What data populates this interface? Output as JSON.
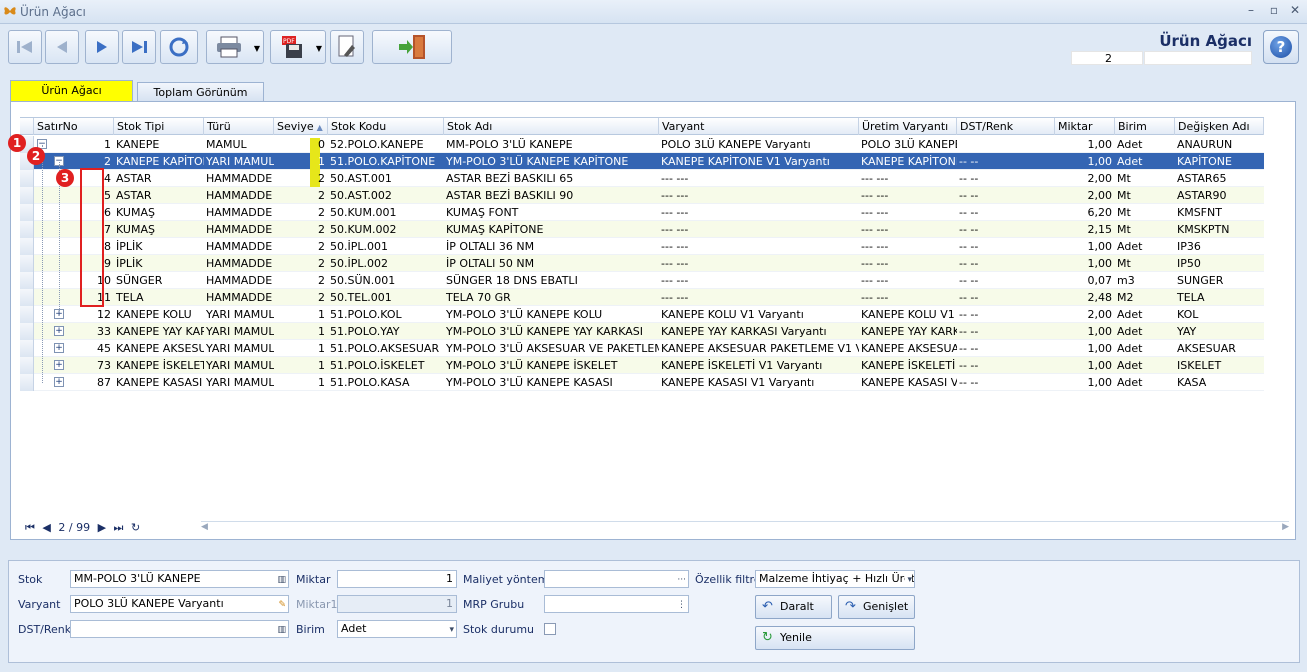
{
  "window": {
    "title": "Ürün Ağacı",
    "minimize": "–",
    "restore": "▫",
    "close": "✕"
  },
  "header": {
    "page_title": "Ürün Ağacı",
    "count_value": "2"
  },
  "tabs": [
    {
      "label": "Ürün Ağacı"
    },
    {
      "label": "Toplam Görünüm"
    }
  ],
  "columns": [
    "SatırNo",
    "Stok Tipi",
    "Türü",
    "Seviye",
    "Stok Kodu",
    "Stok Adı",
    "Varyant",
    "Üretim Varyantı",
    "DST/Renk",
    "Miktar",
    "Birim",
    "Değişken Adı"
  ],
  "rows": [
    {
      "no": "1",
      "tipi": "KANEPE",
      "turu": "MAMUL",
      "seviye": "0",
      "kodu": "52.POLO.KANEPE",
      "adi": "MM-POLO 3'LÜ KANEPE",
      "varyant": "POLO 3LÜ KANEPE Varyantı",
      "uretim": "POLO 3LÜ KANEPE V",
      "dst": "",
      "miktar": "1,00",
      "birim": "Adet",
      "degisken": "ANAURUN",
      "exp": "−"
    },
    {
      "no": "2",
      "tipi": "KANEPE KAPİTONE",
      "turu": "YARI MAMUL",
      "seviye": "1",
      "kodu": "51.POLO.KAPİTONE",
      "adi": "YM-POLO 3'LÜ KANEPE KAPİTONE",
      "varyant": "KANEPE KAPİTONE V1 Varyantı",
      "uretim": "KANEPE KAPİTONE",
      "dst": "-- --",
      "miktar": "1,00",
      "birim": "Adet",
      "degisken": "KAPİTONE",
      "exp": "−"
    },
    {
      "no": "4",
      "tipi": "ASTAR",
      "turu": "HAMMADDE",
      "seviye": "2",
      "kodu": "50.AST.001",
      "adi": "ASTAR BEZİ BASKILI 65",
      "varyant": "--- ---",
      "uretim": "--- ---",
      "dst": "-- --",
      "miktar": "2,00",
      "birim": "Mt",
      "degisken": "ASTAR65",
      "exp": ""
    },
    {
      "no": "5",
      "tipi": "ASTAR",
      "turu": "HAMMADDE",
      "seviye": "2",
      "kodu": "50.AST.002",
      "adi": "ASTAR BEZİ BASKILI 90",
      "varyant": "--- ---",
      "uretim": "--- ---",
      "dst": "-- --",
      "miktar": "2,00",
      "birim": "Mt",
      "degisken": "ASTAR90",
      "exp": ""
    },
    {
      "no": "6",
      "tipi": "KUMAŞ",
      "turu": "HAMMADDE",
      "seviye": "2",
      "kodu": "50.KUM.001",
      "adi": "KUMAŞ FONT",
      "varyant": "--- ---",
      "uretim": "--- ---",
      "dst": "-- --",
      "miktar": "6,20",
      "birim": "Mt",
      "degisken": "KMSFNT",
      "exp": ""
    },
    {
      "no": "7",
      "tipi": "KUMAŞ",
      "turu": "HAMMADDE",
      "seviye": "2",
      "kodu": "50.KUM.002",
      "adi": "KUMAŞ KAPİTONE",
      "varyant": "--- ---",
      "uretim": "--- ---",
      "dst": "-- --",
      "miktar": "2,15",
      "birim": "Mt",
      "degisken": "KMSKPTN",
      "exp": ""
    },
    {
      "no": "8",
      "tipi": "İPLİK",
      "turu": "HAMMADDE",
      "seviye": "2",
      "kodu": "50.İPL.001",
      "adi": "İP OLTALI 36 NM",
      "varyant": "--- ---",
      "uretim": "--- ---",
      "dst": "-- --",
      "miktar": "1,00",
      "birim": "Adet",
      "degisken": "IP36",
      "exp": ""
    },
    {
      "no": "9",
      "tipi": "İPLİK",
      "turu": "HAMMADDE",
      "seviye": "2",
      "kodu": "50.İPL.002",
      "adi": "İP OLTALI 50 NM",
      "varyant": "--- ---",
      "uretim": "--- ---",
      "dst": "-- --",
      "miktar": "1,00",
      "birim": "Mt",
      "degisken": "IP50",
      "exp": ""
    },
    {
      "no": "10",
      "tipi": "SÜNGER",
      "turu": "HAMMADDE",
      "seviye": "2",
      "kodu": "50.SÜN.001",
      "adi": "SÜNGER 18 DNS EBATLI",
      "varyant": "--- ---",
      "uretim": "--- ---",
      "dst": "-- --",
      "miktar": "0,07",
      "birim": "m3",
      "degisken": "SUNGER",
      "exp": ""
    },
    {
      "no": "11",
      "tipi": "TELA",
      "turu": "HAMMADDE",
      "seviye": "2",
      "kodu": "50.TEL.001",
      "adi": "TELA 70 GR",
      "varyant": "--- ---",
      "uretim": "--- ---",
      "dst": "-- --",
      "miktar": "2,48",
      "birim": "M2",
      "degisken": "TELA",
      "exp": ""
    },
    {
      "no": "12",
      "tipi": "KANEPE KOLU",
      "turu": "YARI MAMUL",
      "seviye": "1",
      "kodu": "51.POLO.KOL",
      "adi": "YM-POLO 3'LÜ KANEPE KOLU",
      "varyant": "KANEPE KOLU V1 Varyantı",
      "uretim": "KANEPE KOLU V1 Va",
      "dst": "-- --",
      "miktar": "2,00",
      "birim": "Adet",
      "degisken": "KOL",
      "exp": "+"
    },
    {
      "no": "33",
      "tipi": "KANEPE YAY KARKASI",
      "turu": "YARI MAMUL",
      "seviye": "1",
      "kodu": "51.POLO.YAY",
      "adi": "YM-POLO 3'LÜ KANEPE YAY KARKASI",
      "varyant": "KANEPE YAY KARKASI Varyantı",
      "uretim": "KANEPE YAY KARKA",
      "dst": "-- --",
      "miktar": "1,00",
      "birim": "Adet",
      "degisken": "YAY",
      "exp": "+"
    },
    {
      "no": "45",
      "tipi": "KANEPE AKSESUAR",
      "turu": "YARI MAMUL",
      "seviye": "1",
      "kodu": "51.POLO.AKSESUAR",
      "adi": "YM-POLO 3'LÜ AKSESUAR VE PAKETLEME",
      "varyant": "KANEPE AKSESUAR PAKETLEME V1 Varya",
      "uretim": "KANEPE AKSESUAR",
      "dst": "-- --",
      "miktar": "1,00",
      "birim": "Adet",
      "degisken": "AKSESUAR",
      "exp": "+"
    },
    {
      "no": "73",
      "tipi": "KANEPE İSKELETİ",
      "turu": "YARI MAMUL",
      "seviye": "1",
      "kodu": "51.POLO.İSKELET",
      "adi": "YM-POLO 3'LÜ KANEPE İSKELET",
      "varyant": "KANEPE İSKELETİ V1 Varyantı",
      "uretim": "KANEPE İSKELETİ V",
      "dst": "-- --",
      "miktar": "1,00",
      "birim": "Adet",
      "degisken": "ISKELET",
      "exp": "+"
    },
    {
      "no": "87",
      "tipi": "KANEPE KASASI",
      "turu": "YARI MAMUL",
      "seviye": "1",
      "kodu": "51.POLO.KASA",
      "adi": "YM-POLO 3'LÜ KANEPE KASASI",
      "varyant": "KANEPE KASASI V1 Varyantı",
      "uretim": "KANEPE KASASI V1",
      "dst": "-- --",
      "miktar": "1,00",
      "birim": "Adet",
      "degisken": "KASA",
      "exp": "+"
    }
  ],
  "badges": [
    "1",
    "2",
    "3"
  ],
  "pager": {
    "first": "⏮",
    "prev": "◀",
    "position": "2 / 99",
    "next": "▶",
    "last": "⏭",
    "refresh": "↻"
  },
  "form": {
    "stok_label": "Stok",
    "stok_value": "MM-POLO 3'LÜ KANEPE",
    "varyant_label": "Varyant",
    "varyant_value": "POLO 3LÜ KANEPE Varyantı",
    "dst_label": "DST/Renk",
    "dst_value": "",
    "miktar_label": "Miktar",
    "miktar_value": "1",
    "miktar1_label": "Miktar1",
    "miktar1_value": "1",
    "birim_label": "Birim",
    "birim_value": "Adet",
    "maliyet_label": "Maliyet yöntemi",
    "maliyet_value": "",
    "mrp_label": "MRP Grubu",
    "mrp_value": "",
    "stok_durumu_label": "Stok durumu",
    "ozellik_label": "Özellik filtre",
    "ozellik_value": "Malzeme İhtiyaç + Hızlı Üretim",
    "daralt_label": "Daralt",
    "genislet_label": "Genişlet",
    "yenile_label": "Yenile"
  },
  "colors": {
    "selected_row": "#3465b3",
    "alt_row": "#f7fbe9",
    "badge": "#e02020",
    "active_tab": "#ffff00"
  }
}
